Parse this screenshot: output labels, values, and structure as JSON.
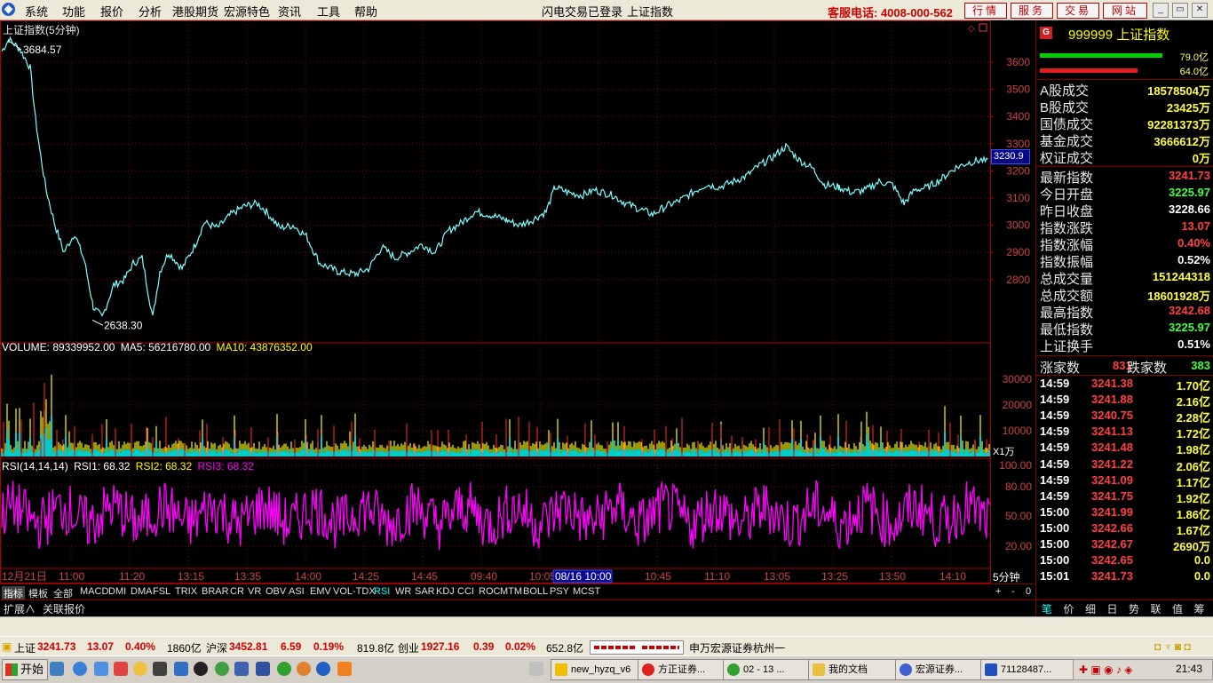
{
  "menu": [
    "系统",
    "功能",
    "报价",
    "分析",
    "港股期货",
    "宏源特色",
    "资讯",
    "工具",
    "帮助"
  ],
  "login_status": "闪电交易已登录",
  "current_symbol": "上证指数",
  "hotline": "客服电话: 4008-000-562",
  "top_buttons": [
    "行情",
    "服务",
    "交易",
    "网站"
  ],
  "window_controls": [
    "_",
    "▭",
    "✕"
  ],
  "chart": {
    "title": "上证指数(5分钟)",
    "high_label": "3684.57",
    "low_label": "2638.30",
    "price_axis": [
      "3600",
      "3500",
      "3400",
      "3300",
      "3200",
      "3100",
      "3000",
      "2900",
      "2800"
    ],
    "current_price_tag": "3230.9",
    "volume_legend": {
      "volume": "VOLUME: 89339952.00",
      "ma5": "MA5: 56216780.00",
      "ma10": "MA10: 43876352.00"
    },
    "volume_axis": [
      "30000",
      "20000",
      "10000"
    ],
    "volume_unit": "X1万",
    "rsi_legend": {
      "params": "RSI(14,14,14)",
      "rsi1": "RSI1: 68.32",
      "rsi2": "RSI2: 68.32",
      "rsi3": "RSI3: 68.32"
    },
    "rsi_axis": [
      "100.00",
      "80.00",
      "50.00",
      "20.00"
    ],
    "time_axis": [
      "12月21日",
      "11:00",
      "11:20",
      "13:15",
      "13:35",
      "14:00",
      "14:25",
      "14:45",
      "09:40",
      "10:05",
      "08/16 10:00",
      "10:45",
      "11:10",
      "13:05",
      "13:25",
      "13:50",
      "14:10"
    ],
    "period": "5分钟",
    "colors": {
      "price_line": "#7fffff",
      "up": "#ff3030",
      "volume_cyan": "#00ffff",
      "volume_yellow": "#ffff00",
      "rsi": "#ff00ff",
      "grid": "#800000"
    }
  },
  "indicator_tabs": [
    "指标",
    "模板",
    "全部",
    "MACD",
    "DMI",
    "DMA",
    "FSL",
    "TRIX",
    "BRAR",
    "CR",
    "VR",
    "OBV",
    "ASI",
    "EMV",
    "VOL-TDX",
    "RSI",
    "WR",
    "SAR",
    "KDJ",
    "CCI",
    "ROC",
    "MTM",
    "BOLL",
    "PSY",
    "MCST"
  ],
  "active_indicator": "RSI",
  "tab_controls": [
    "+",
    "-",
    "0"
  ],
  "sub_tabs": [
    "扩展∧",
    "关联报价"
  ],
  "quote": {
    "code_name": "999999 上证指数",
    "bar1_value": "79.0亿",
    "bar2_value": "64.0亿",
    "volumes": [
      {
        "label": "A股成交",
        "value": "18578504万",
        "color": "#ffff40"
      },
      {
        "label": "B股成交",
        "value": "23425万",
        "color": "#ffff40"
      },
      {
        "label": "国债成交",
        "value": "92281373万",
        "color": "#ffff40"
      },
      {
        "label": "基金成交",
        "value": "3666612万",
        "color": "#ffff40"
      },
      {
        "label": "权证成交",
        "value": "0万",
        "color": "#ffff40"
      }
    ],
    "stats": [
      {
        "label": "最新指数",
        "value": "3241.73",
        "color": "#ff4040"
      },
      {
        "label": "今日开盘",
        "value": "3225.97",
        "color": "#40ff40"
      },
      {
        "label": "昨日收盘",
        "value": "3228.66",
        "color": "#ffffff"
      },
      {
        "label": "指数涨跌",
        "value": "13.07",
        "color": "#ff4040"
      },
      {
        "label": "指数涨幅",
        "value": "0.40%",
        "color": "#ff4040"
      },
      {
        "label": "指数振幅",
        "value": "0.52%",
        "color": "#ffffff"
      },
      {
        "label": "总成交量",
        "value": "151244318",
        "color": "#ffff40"
      },
      {
        "label": "总成交额",
        "value": "18601928万",
        "color": "#ffff40"
      },
      {
        "label": "最高指数",
        "value": "3242.68",
        "color": "#ff4040"
      },
      {
        "label": "最低指数",
        "value": "3225.97",
        "color": "#40ff40"
      },
      {
        "label": "上证换手",
        "value": "0.51%",
        "color": "#ffffff"
      }
    ],
    "up_label": "涨家数",
    "up_count": "831",
    "down_label": "跌家数",
    "down_count": "383",
    "ticks": [
      {
        "time": "14:59",
        "price": "3241.38",
        "amount": "1.70亿"
      },
      {
        "time": "14:59",
        "price": "3241.88",
        "amount": "2.16亿"
      },
      {
        "time": "14:59",
        "price": "3240.75",
        "amount": "2.28亿"
      },
      {
        "time": "14:59",
        "price": "3241.13",
        "amount": "1.72亿"
      },
      {
        "time": "14:59",
        "price": "3241.48",
        "amount": "1.98亿"
      },
      {
        "time": "14:59",
        "price": "3241.22",
        "amount": "2.06亿"
      },
      {
        "time": "14:59",
        "price": "3241.09",
        "amount": "1.17亿"
      },
      {
        "time": "14:59",
        "price": "3241.75",
        "amount": "1.92亿"
      },
      {
        "time": "15:00",
        "price": "3241.99",
        "amount": "1.86亿"
      },
      {
        "time": "15:00",
        "price": "3242.66",
        "amount": "1.67亿"
      },
      {
        "time": "15:00",
        "price": "3242.67",
        "amount": "2690万"
      },
      {
        "time": "15:00",
        "price": "3242.65",
        "amount": "0.0"
      },
      {
        "time": "15:01",
        "price": "3241.73",
        "amount": "0.0"
      }
    ],
    "tabs": [
      "笔",
      "价",
      "细",
      "日",
      "势",
      "联",
      "值",
      "筹"
    ]
  },
  "statusbar": {
    "sh_label": "上证",
    "sh_index": "3241.73",
    "sh_change": "13.07",
    "sh_pct": "0.40%",
    "sh_amount": "1860亿",
    "hs_label": "沪深",
    "hs_index": "3452.81",
    "hs_change": "6.59",
    "hs_pct": "0.19%",
    "hs_amount": "819.8亿",
    "cy_label": "创业",
    "cy_index": "1927.16",
    "cy_change": "0.39",
    "cy_pct": "0.02%",
    "cy_amount": "652.8亿",
    "broker": "申万宏源证券杭州一"
  },
  "taskbar": {
    "start": "开始",
    "windows": [
      "new_hyzq_v6",
      "方正证券...",
      "02 - 13 ...",
      "我的文档",
      "宏源证券...",
      "71128487..."
    ],
    "clock": "21:43"
  }
}
